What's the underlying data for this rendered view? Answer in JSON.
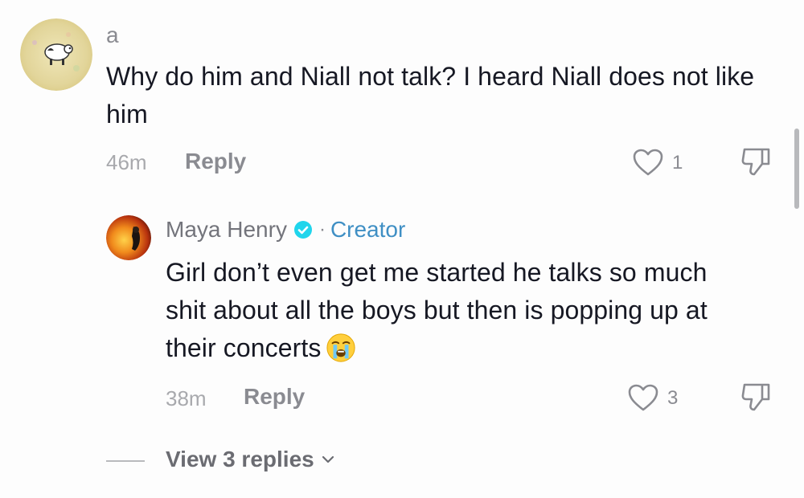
{
  "comments": [
    {
      "username": "a",
      "text": "Why do him and Niall not talk? I heard Niall does not like him",
      "time": "46m",
      "reply_label": "Reply",
      "likes": "1",
      "avatar_icon": "cow-cartoon-avatar"
    },
    {
      "username": "Maya Henry",
      "verified": true,
      "separator": "·",
      "badge_label": "Creator",
      "text": "Girl don’t even get me started he talks so much shit about all the boys but then is popping up at their concerts",
      "emoji": "loudly-crying-face",
      "time": "38m",
      "reply_label": "Reply",
      "likes": "3",
      "avatar_icon": "fire-photo-avatar"
    }
  ],
  "view_replies_label": "View 3 replies",
  "colors": {
    "text": "#161823",
    "muted": "#8a8b91",
    "creator": "#3f8fc4",
    "verified": "#20d5ec"
  }
}
